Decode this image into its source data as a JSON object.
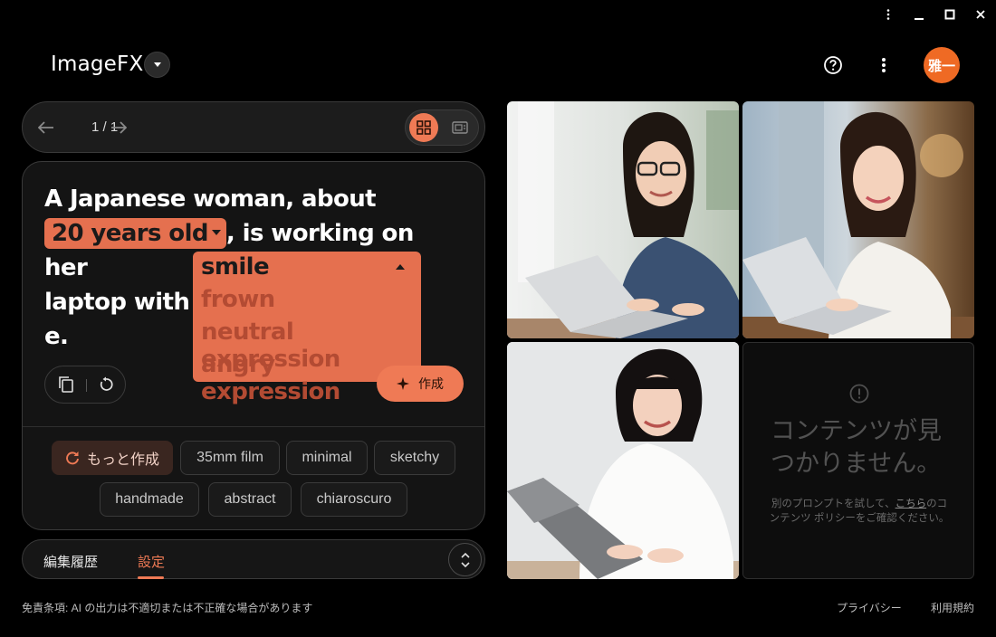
{
  "app": {
    "title": "ImageFX",
    "avatar_text": "雅一",
    "accent": "#ef7a55"
  },
  "pager": {
    "count": "1 / 1"
  },
  "prompt": {
    "line1": "A Japanese woman, about",
    "chip1": "20 years old",
    "mid": ", is working on her",
    "line3_pre": "laptop with a ",
    "line3_tail": "e."
  },
  "dropdown": {
    "selected": "smile",
    "options": [
      "frown",
      "neutral expression",
      "angry expression"
    ]
  },
  "create_label": "作成",
  "chips": [
    "もっと作成",
    "35mm film",
    "minimal",
    "sketchy",
    "handmade",
    "abstract",
    "chiaroscuro"
  ],
  "tabs": {
    "history": "編集履歴",
    "settings": "設定"
  },
  "empty": {
    "title": "コンテンツが見つかりません。",
    "desc_pre": "別のプロンプトを試して、",
    "desc_link": "こちら",
    "desc_post": "のコンテンツ ポリシーをご確認ください。"
  },
  "footer": {
    "disclaimer": "免責条項: AI の出力は不適切または不正確な場合があります",
    "privacy": "プライバシー",
    "terms": "利用規約"
  }
}
